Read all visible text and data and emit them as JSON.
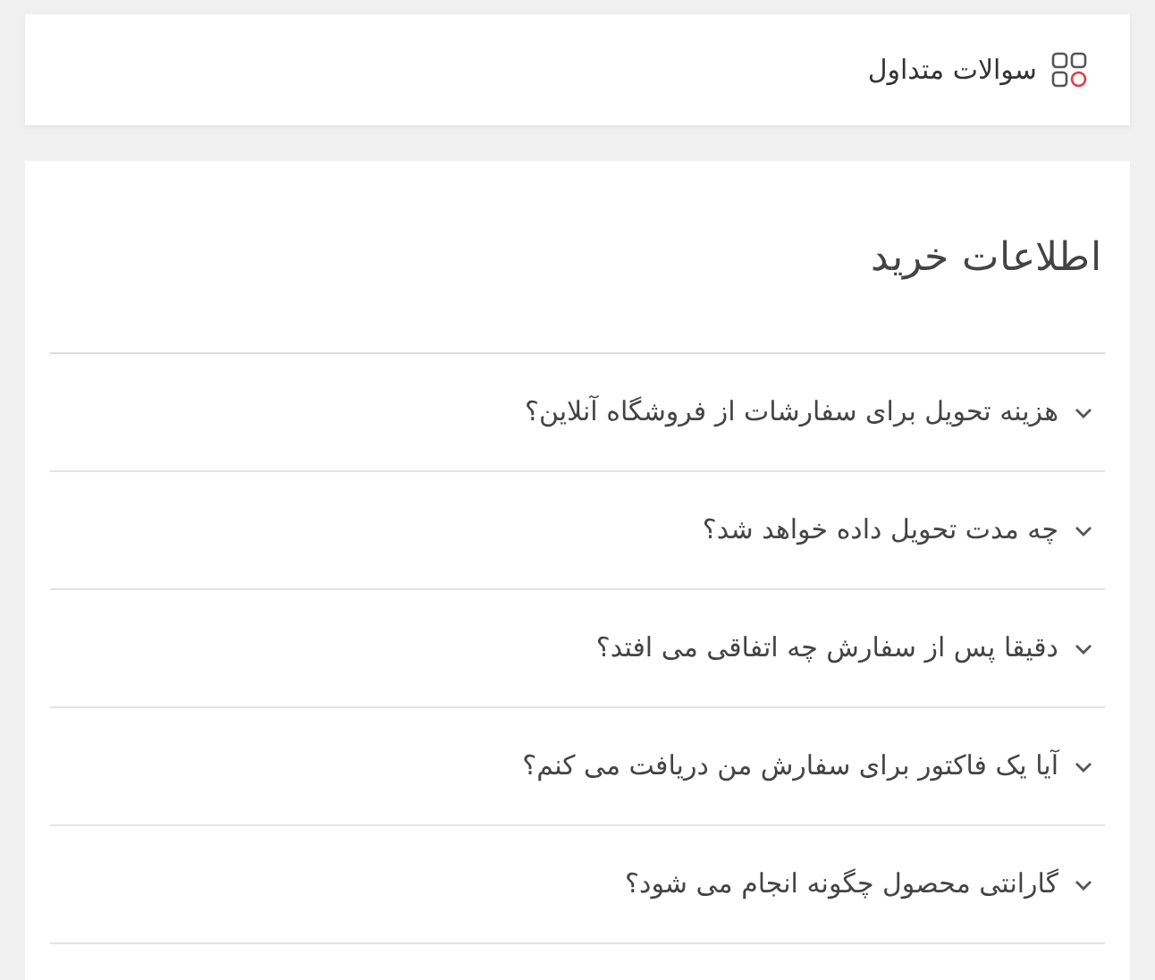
{
  "header": {
    "title": "سوالات متداول"
  },
  "section": {
    "title": "اطلاعات خرید"
  },
  "questions": [
    {
      "text": "هزینه تحویل برای سفارشات از فروشگاه آنلاین؟",
      "expanded": false
    },
    {
      "text": "چه مدت تحویل داده خواهد شد؟",
      "expanded": false
    },
    {
      "text": "دقیقا پس از سفارش چه اتفاقی می افتد؟",
      "expanded": false
    },
    {
      "text": "آیا یک فاکتور برای سفارش من دریافت می کنم؟",
      "expanded": false
    },
    {
      "text": "گارانتی محصول چگونه انجام می شود؟",
      "expanded": false
    }
  ]
}
